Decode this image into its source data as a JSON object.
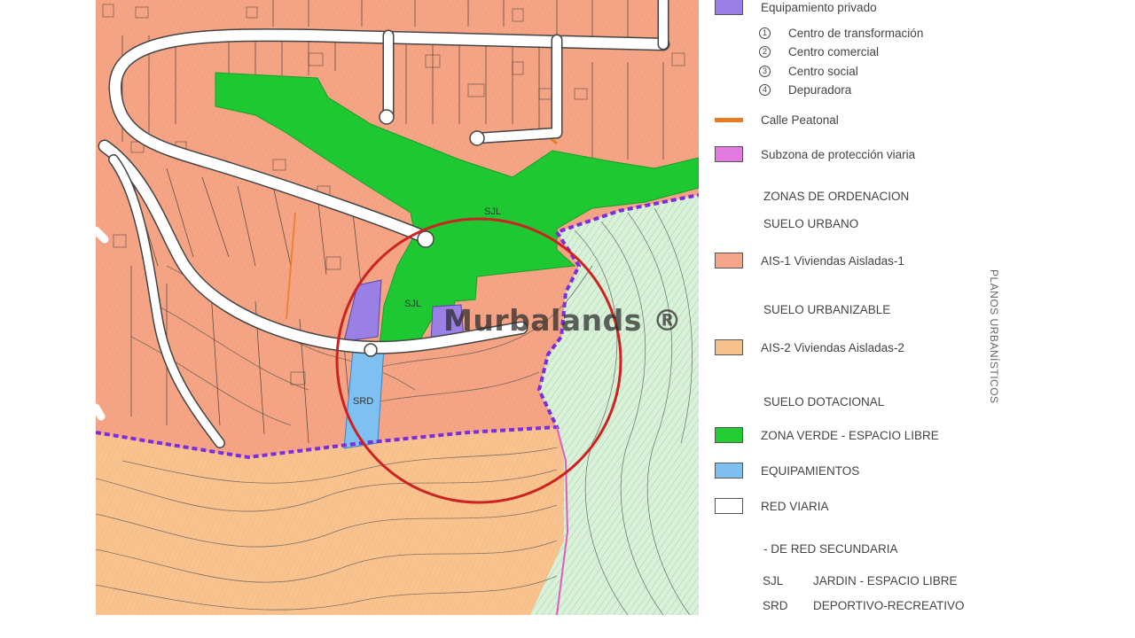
{
  "watermark": "Murbalands ®",
  "map_labels": {
    "sjl_1": "SJL",
    "sjl_2": "SJL",
    "srd": "SRD"
  },
  "side_text": "PLANOS URBANÍSTICOS",
  "legend": {
    "privado": {
      "label": "Equipamiento privado",
      "color": "#9b7fe6"
    },
    "numbered": [
      {
        "n": "1",
        "label": "Centro de transformación"
      },
      {
        "n": "2",
        "label": "Centro comercial"
      },
      {
        "n": "3",
        "label": "Centro social"
      },
      {
        "n": "4",
        "label": "Depuradora"
      }
    ],
    "peatonal": {
      "label": "Calle Peatonal",
      "color": "#e87a22"
    },
    "proteccion": {
      "label": "Subzona de protección viaria",
      "color": "#e27ae0"
    },
    "zonas_header": "ZONAS DE ORDENACION",
    "suelo_urbano": "SUELO URBANO",
    "ais1": {
      "label": "AIS-1  Viviendas Aisladas-1",
      "color": "#f4a58a"
    },
    "suelo_urbanizable": "SUELO URBANIZABLE",
    "ais2": {
      "label": "AIS-2  Viviendas Aisladas-2",
      "color": "#f8c28e"
    },
    "suelo_dotacional": "SUELO DOTACIONAL",
    "zona_verde": {
      "label": "ZONA VERDE - ESPACIO LIBRE",
      "color": "#22cc33"
    },
    "equipamientos": {
      "label": "EQUIPAMIENTOS",
      "color": "#7fbff0"
    },
    "red_viaria": {
      "label": "RED VIARIA",
      "color": "#ffffff"
    },
    "red_secundaria": "- DE RED SECUNDARIA",
    "abbr": [
      {
        "code": "SJL",
        "label": "JARDIN - ESPACIO LIBRE"
      },
      {
        "code": "SRD",
        "label": "DEPORTIVO-RECREATIVO"
      }
    ]
  }
}
